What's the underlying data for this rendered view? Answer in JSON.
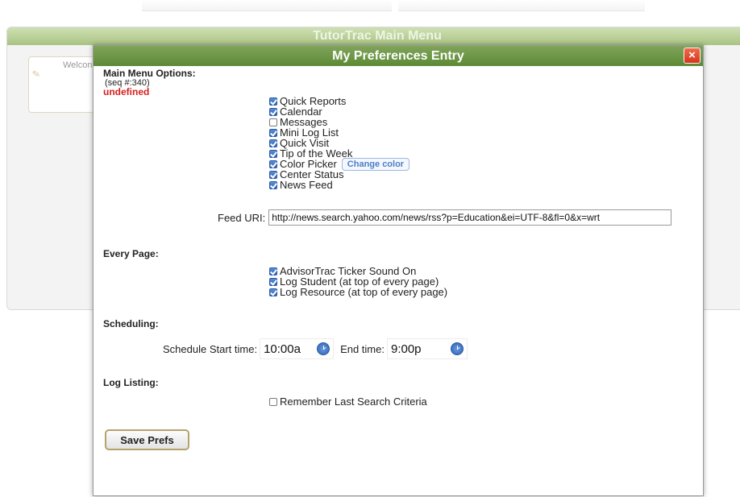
{
  "background": {
    "panel_title": "TutorTrac Main Menu",
    "welcome_text": "Welcon"
  },
  "dialog": {
    "title": "My Preferences Entry",
    "close_label": "×"
  },
  "main_menu": {
    "title": "Main Menu Options:",
    "seq": "(seq #:340)",
    "status": "undefined",
    "options": [
      {
        "label": "Quick Reports",
        "checked": true
      },
      {
        "label": "Calendar",
        "checked": true
      },
      {
        "label": "Messages",
        "checked": false
      },
      {
        "label": "Mini Log List",
        "checked": true
      },
      {
        "label": "Quick Visit",
        "checked": true
      },
      {
        "label": "Tip of the Week",
        "checked": true
      },
      {
        "label": "Color Picker",
        "checked": true
      },
      {
        "label": "Center Status",
        "checked": true
      },
      {
        "label": "News Feed",
        "checked": true
      }
    ],
    "change_color_label": "Change color",
    "feed_label": "Feed URI:",
    "feed_value": "http://news.search.yahoo.com/news/rss?p=Education&ei=UTF-8&fl=0&x=wrt"
  },
  "every_page": {
    "title": "Every Page:",
    "options": [
      {
        "label": "AdvisorTrac Ticker Sound On",
        "checked": true
      },
      {
        "label": "Log Student (at top of every page)",
        "checked": true
      },
      {
        "label": "Log Resource (at top of every page)",
        "checked": true
      }
    ]
  },
  "scheduling": {
    "title": "Scheduling:",
    "start_label": "Schedule Start time:",
    "start_value": "10:00a",
    "end_label": "End time:",
    "end_value": "9:00p"
  },
  "log_listing": {
    "title": "Log Listing:",
    "remember_label": "Remember Last Search Criteria",
    "remember_checked": false
  },
  "save_label": "Save Prefs",
  "colors": {
    "header_green": "#5d8a36",
    "close_red": "#d8341a",
    "status_red": "#d81e1e",
    "checkbox_blue": "#2d64b8"
  }
}
